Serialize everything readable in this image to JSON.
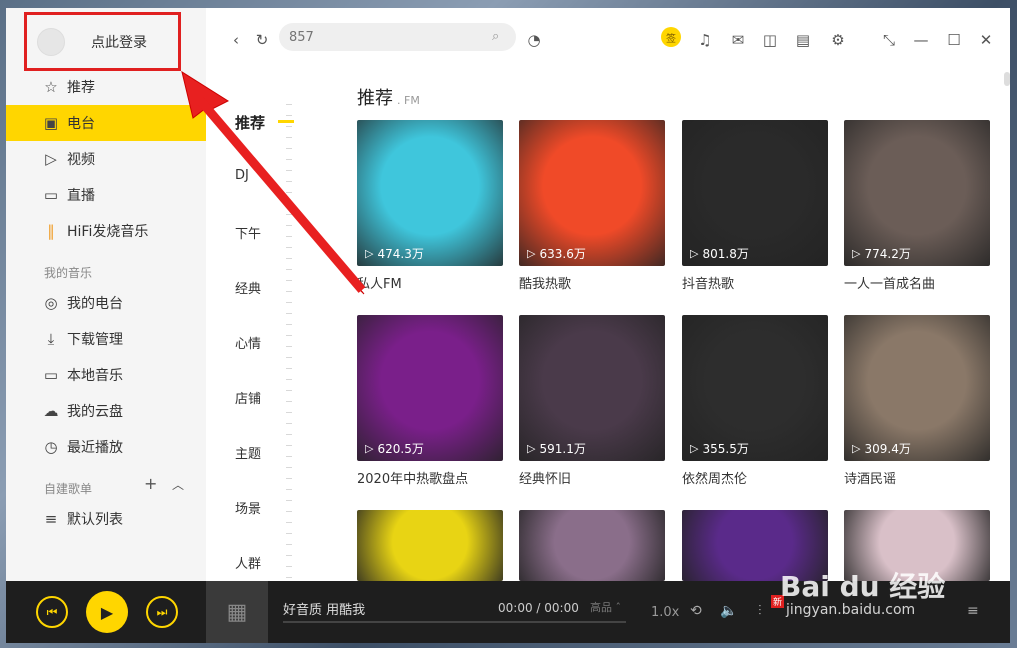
{
  "sidebar": {
    "login_text": "点此登录",
    "items": [
      {
        "label": "推荐",
        "icon": "star-icon"
      },
      {
        "label": "电台",
        "icon": "radio-icon"
      },
      {
        "label": "视频",
        "icon": "video-icon"
      },
      {
        "label": "直播",
        "icon": "live-icon"
      },
      {
        "label": "HiFi发烧音乐",
        "icon": "hifi-icon"
      }
    ],
    "my_music_title": "我的音乐",
    "my_music": [
      {
        "label": "我的电台",
        "icon": "my-radio-icon"
      },
      {
        "label": "下载管理",
        "icon": "download-icon"
      },
      {
        "label": "本地音乐",
        "icon": "local-music-icon"
      },
      {
        "label": "我的云盘",
        "icon": "cloud-icon"
      },
      {
        "label": "最近播放",
        "icon": "recent-icon"
      }
    ],
    "playlist_title": "自建歌单",
    "playlists": [
      {
        "label": "默认列表"
      }
    ]
  },
  "topbar": {
    "search_placeholder": "857",
    "sign_label": "签"
  },
  "categories": [
    "推荐",
    "DJ",
    "下午",
    "经典",
    "心情",
    "店铺",
    "主题",
    "场景",
    "人群"
  ],
  "section": {
    "title": "推荐",
    "subtitle": ". FM"
  },
  "cards": [
    {
      "title": "私人FM",
      "count": "474.3万",
      "color": "#3fc6dc"
    },
    {
      "title": "酷我热歌",
      "count": "633.6万",
      "color": "#f04a28"
    },
    {
      "title": "抖音热歌",
      "count": "801.8万",
      "color": "#2a2a2a"
    },
    {
      "title": "一人一首成名曲",
      "count": "774.2万",
      "color": "#6b5d57"
    },
    {
      "title": "2020年中热歌盘点",
      "count": "620.5万",
      "color": "#7a1f8a"
    },
    {
      "title": "经典怀旧",
      "count": "591.1万",
      "color": "#4a3a4a"
    },
    {
      "title": "依然周杰伦",
      "count": "355.5万",
      "color": "#2d2d2d"
    },
    {
      "title": "诗酒民谣",
      "count": "309.4万",
      "color": "#8a7868"
    },
    {
      "title": "",
      "count": "",
      "color": "#e8d414"
    },
    {
      "title": "",
      "count": "",
      "color": "#8a6e8a"
    },
    {
      "title": "",
      "count": "",
      "color": "#5a2a8a"
    },
    {
      "title": "",
      "count": "",
      "color": "#d9c0c8"
    }
  ],
  "player": {
    "song": "好音质 用酷我",
    "time": "00:00 / 00:00",
    "quality": "高品 ˆ",
    "speed": "1.0x",
    "new_badge": "新"
  },
  "watermark": {
    "text": "Bai du 经验",
    "url": "jingyan.baidu.com"
  }
}
